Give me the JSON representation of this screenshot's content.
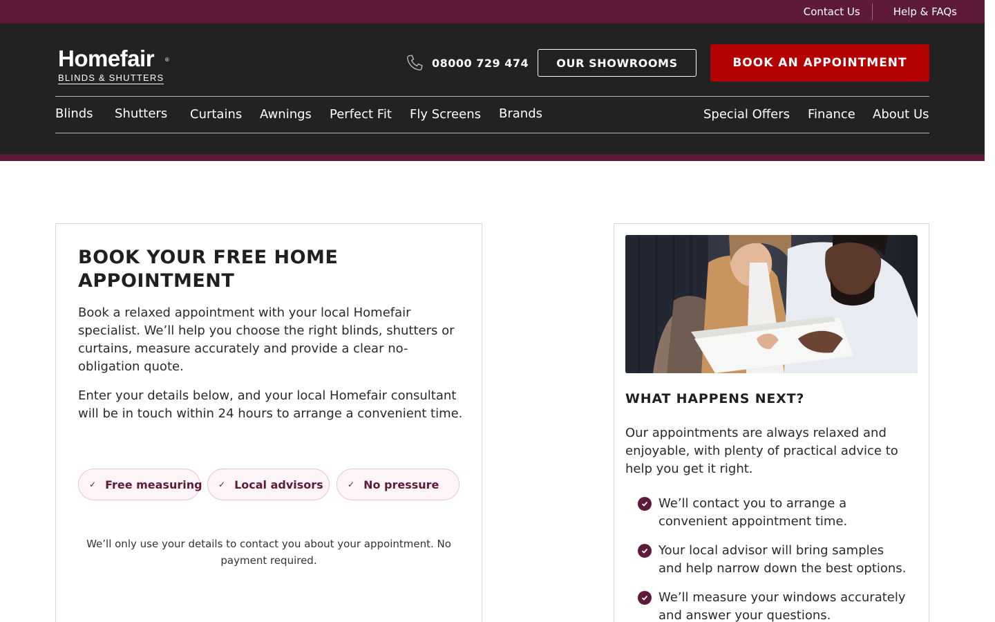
{
  "topbar": {
    "contact": "Contact Us",
    "help": "Help & FAQs"
  },
  "header": {
    "logo_brand": "Homefair",
    "logo_sub": "BLINDS & SHUTTERS",
    "phone": "08000 729 474",
    "showrooms": "OUR SHOWROOMS",
    "book": "BOOK AN APPOINTMENT"
  },
  "nav": {
    "left": [
      "Blinds",
      "Shutters",
      "Curtains",
      "Awnings",
      "Perfect Fit",
      "Fly Screens",
      "Brands"
    ],
    "right": [
      "Special Offers",
      "Finance",
      "About Us"
    ]
  },
  "booking": {
    "title": "BOOK YOUR FREE HOME APPOINTMENT",
    "p1": "Book a relaxed appointment with your local Homefair specialist. We’ll help you choose the right blinds, shutters or curtains, measure accurately and provide a clear no-obligation quote.",
    "p2": "Enter your details below, and your local Homefair consultant will be in touch within 24 hours to arrange a convenient time.",
    "pills": [
      "Free measuring",
      "Local advisors",
      "No pressure"
    ],
    "disclaimer": "We’ll only use your details to contact you about your appointment. No payment required."
  },
  "next": {
    "title": "WHAT HAPPENS NEXT?",
    "intro": "Our appointments are always relaxed and enjoyable, with plenty of practical advice to help you get it right.",
    "steps": [
      "We’ll contact you to arrange a convenient appointment time.",
      "Your local advisor will bring samples and help narrow down the best options.",
      "We’ll measure your windows accurately and answer your questions."
    ]
  },
  "colors": {
    "plum": "#5e1a3a",
    "header": "#222222",
    "cta": "#b30000"
  }
}
